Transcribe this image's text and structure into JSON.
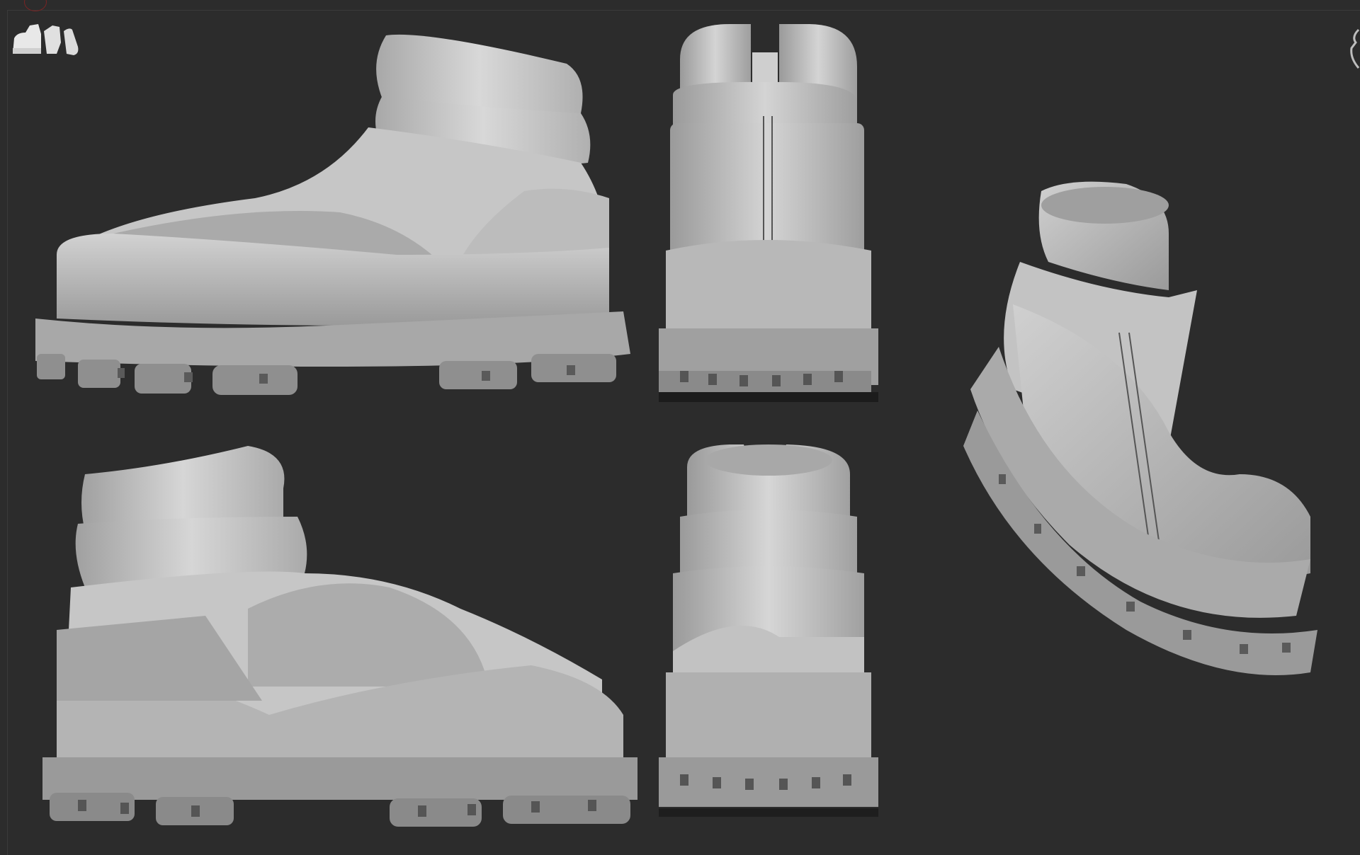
{
  "app": {
    "name": "",
    "title": ""
  },
  "viewport": {
    "background": "#2c2c2c",
    "model_color": "#bdbdbd"
  },
  "icons": {
    "subtool_thumbnail": "boot-subtools-thumbnail-icon",
    "record_indicator": "record-indicator-icon",
    "navigation_gizmo": "navigation-gizmo-icon"
  },
  "views": [
    {
      "name": "side-view-outer"
    },
    {
      "name": "back-view"
    },
    {
      "name": "perspective-view"
    },
    {
      "name": "side-view-inner"
    },
    {
      "name": "front-view"
    }
  ]
}
